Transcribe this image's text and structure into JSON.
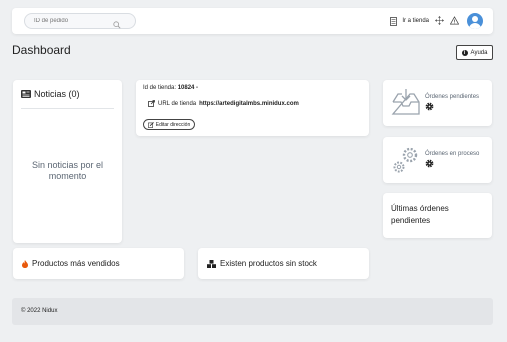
{
  "topbar": {
    "search_placeholder": "ID de pedido",
    "store_link": "Ir a tienda"
  },
  "page": {
    "title": "Dashboard",
    "help_label": "Ayuda"
  },
  "news": {
    "title": "Noticias (0)",
    "empty": "Sin noticias por el momento"
  },
  "store": {
    "id_label": "Id de tienda:",
    "id_value": "10824 -",
    "url_label": "URL de tienda",
    "url_value": "https://artedigitalmbs.minidux.com",
    "edit_label": "Editar dirección"
  },
  "orders": {
    "pending_label": "Órdenes pendientes",
    "process_label": "Órdenes en proceso",
    "last_title": "Últimas órdenes pendientes"
  },
  "products": {
    "best_sellers": "Productos más vendidos",
    "out_of_stock": "Existen productos sin stock"
  },
  "footer": {
    "copyright": "© 2022 Nidux"
  },
  "icons": {
    "search": "search-icon",
    "store": "store-icon",
    "move": "move-icon",
    "alert": "alert-icon",
    "avatar": "user-icon",
    "info": "info-icon",
    "news": "newspaper-icon",
    "external": "external-link-icon",
    "edit": "edit-icon",
    "inbox": "inbox-icon",
    "gears": "gears-icon",
    "gear": "gear-icon",
    "fire": "fire-icon",
    "boxes": "boxes-icon"
  },
  "colors": {
    "accent": "#4a90d9",
    "background": "#eef0f2",
    "muted_text": "#5b6673"
  }
}
